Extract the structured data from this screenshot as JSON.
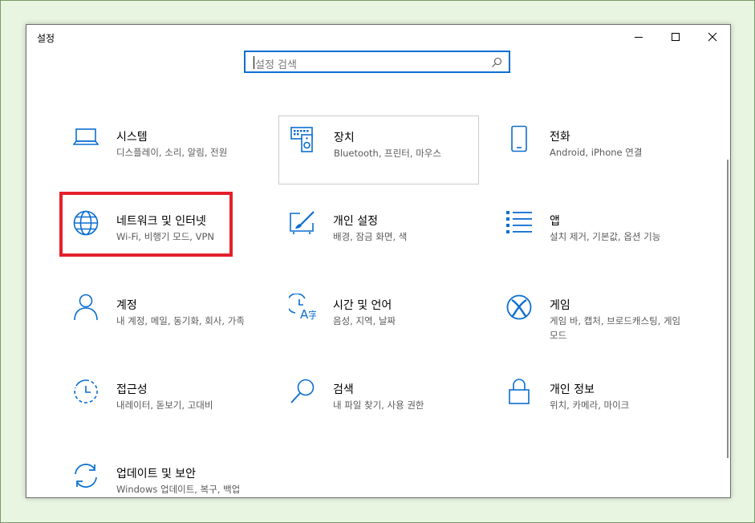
{
  "window": {
    "title": "설정"
  },
  "search": {
    "placeholder": "설정 검색"
  },
  "tiles": [
    {
      "title": "시스템",
      "subtitle": "디스플레이, 소리, 알림, 전원",
      "icon": "laptop-icon"
    },
    {
      "title": "장치",
      "subtitle": "Bluetooth, 프린터, 마우스",
      "icon": "devices-icon"
    },
    {
      "title": "전화",
      "subtitle": "Android, iPhone 연결",
      "icon": "phone-icon"
    },
    {
      "title": "네트워크 및 인터넷",
      "subtitle": "Wi-Fi, 비행기 모드, VPN",
      "icon": "globe-icon"
    },
    {
      "title": "개인 설정",
      "subtitle": "배경, 잠금 화면, 색",
      "icon": "personalization-icon"
    },
    {
      "title": "앱",
      "subtitle": "설치 제거, 기본값, 옵션 기능",
      "icon": "apps-icon"
    },
    {
      "title": "계정",
      "subtitle": "내 계정, 메일, 동기화, 회사, 가족",
      "icon": "person-icon"
    },
    {
      "title": "시간 및 언어",
      "subtitle": "음성, 지역, 날짜",
      "icon": "time-language-icon"
    },
    {
      "title": "게임",
      "subtitle": "게임 바, 캡처, 브로드캐스팅, 게임 모드",
      "icon": "xbox-icon"
    },
    {
      "title": "접근성",
      "subtitle": "내레이터, 돋보기, 고대비",
      "icon": "accessibility-icon"
    },
    {
      "title": "검색",
      "subtitle": "내 파일 찾기, 사용 권한",
      "icon": "search-icon"
    },
    {
      "title": "개인 정보",
      "subtitle": "위치, 카메라, 마이크",
      "icon": "lock-icon"
    },
    {
      "title": "업데이트 및 보안",
      "subtitle": "Windows 업데이트, 복구, 백업",
      "icon": "sync-icon"
    }
  ],
  "colors": {
    "accent": "#0b6ed0",
    "highlight": "#e3202b",
    "background": "#e8f5e1"
  }
}
